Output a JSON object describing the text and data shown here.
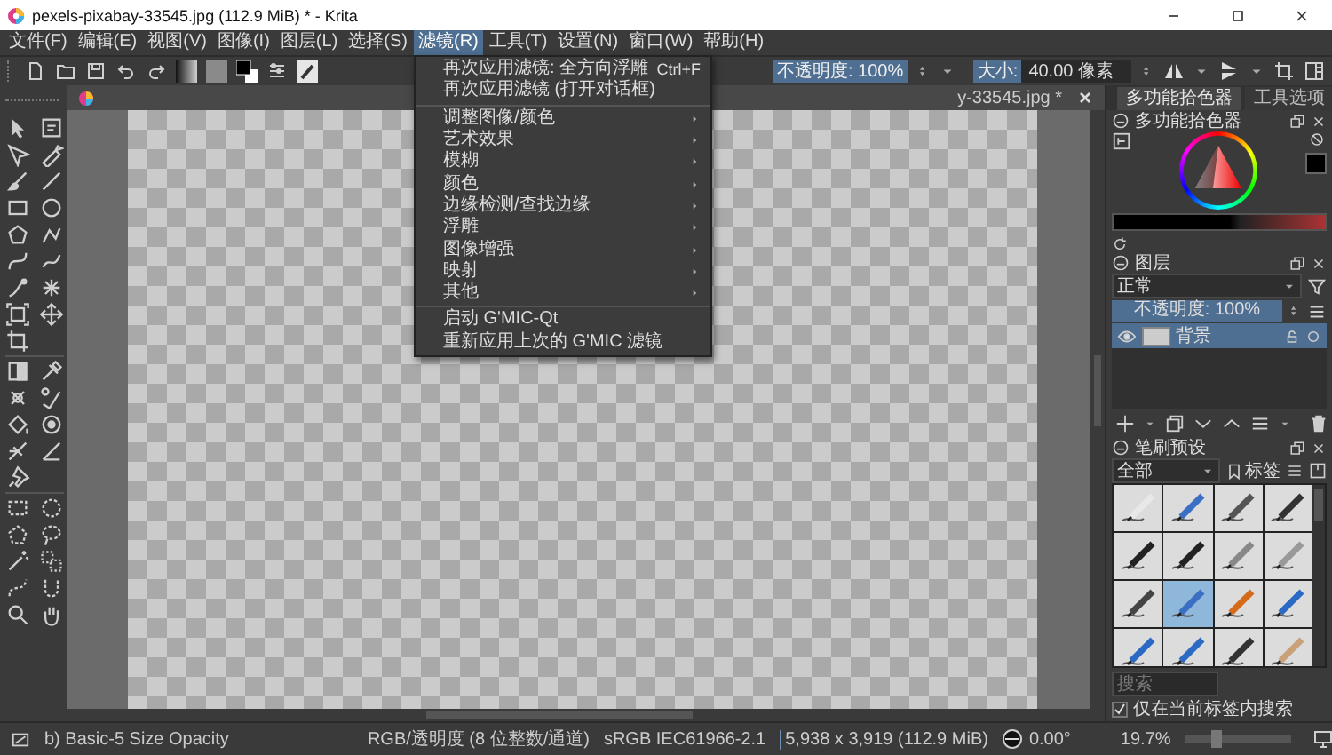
{
  "window": {
    "title": "pexels-pixabay-33545.jpg (112.9 MiB) * - Krita"
  },
  "menu_bar": [
    {
      "label": "文件(F)",
      "selected": false
    },
    {
      "label": "编辑(E)",
      "selected": false
    },
    {
      "label": "视图(V)",
      "selected": false
    },
    {
      "label": "图像(I)",
      "selected": false
    },
    {
      "label": "图层(L)",
      "selected": false
    },
    {
      "label": "选择(S)",
      "selected": false
    },
    {
      "label": "滤镜(R)",
      "selected": true
    },
    {
      "label": "工具(T)",
      "selected": false
    },
    {
      "label": "设置(N)",
      "selected": false
    },
    {
      "label": "窗口(W)",
      "selected": false
    },
    {
      "label": "帮助(H)",
      "selected": false
    }
  ],
  "filter_menu": {
    "groups": [
      [
        {
          "label": "再次应用滤镜: 全方向浮雕",
          "shortcut": "Ctrl+F",
          "kind": "action"
        },
        {
          "label": "再次应用滤镜 (打开对话框)",
          "kind": "action"
        }
      ],
      [
        {
          "label": "调整图像/颜色",
          "kind": "submenu"
        },
        {
          "label": "艺术效果",
          "kind": "submenu"
        },
        {
          "label": "模糊",
          "kind": "submenu"
        },
        {
          "label": "颜色",
          "kind": "submenu"
        },
        {
          "label": "边缘检测/查找边缘",
          "kind": "submenu"
        },
        {
          "label": "浮雕",
          "kind": "submenu"
        },
        {
          "label": "图像增强",
          "kind": "submenu"
        },
        {
          "label": "映射",
          "kind": "submenu"
        },
        {
          "label": "其他",
          "kind": "submenu"
        }
      ],
      [
        {
          "label": "启动 G'MIC-Qt",
          "kind": "action"
        },
        {
          "label": "重新应用上次的 G'MIC 滤镜",
          "kind": "action"
        }
      ]
    ]
  },
  "toolbar": {
    "opacity": {
      "text": "不透明度: 100%",
      "level": 1
    },
    "size": {
      "label": "大小:",
      "value": "40.00 像素",
      "level": 0.3
    }
  },
  "document_tab": {
    "label": "y-33545.jpg *"
  },
  "dock": {
    "tabs": [
      {
        "label": "多功能拾色器",
        "selected": true
      },
      {
        "label": "工具选项",
        "selected": false
      }
    ],
    "color_selector": {
      "title": "多功能拾色器"
    },
    "layers": {
      "title": "图层",
      "blend_mode": "正常",
      "opacity": {
        "text": "不透明度: 100%",
        "level": 1
      },
      "items": [
        {
          "name": "背景",
          "selected": true,
          "visible": true
        }
      ]
    },
    "brush_presets": {
      "title": "笔刷预设",
      "filter": "全部",
      "tag_label": "标签",
      "search": {
        "placeholder": "搜索"
      },
      "search_in_tag": {
        "label": "仅在当前标签内搜索",
        "checked": true
      },
      "presets": [
        {
          "selected": false
        },
        {
          "selected": false
        },
        {
          "selected": false
        },
        {
          "selected": false
        },
        {
          "selected": false
        },
        {
          "selected": false
        },
        {
          "selected": false
        },
        {
          "selected": false
        },
        {
          "selected": false
        },
        {
          "selected": true
        },
        {
          "selected": false
        },
        {
          "selected": false
        },
        {
          "selected": false
        },
        {
          "selected": false
        },
        {
          "selected": false
        },
        {
          "selected": false
        }
      ]
    }
  },
  "status_bar": {
    "brush": "b) Basic-5 Size Opacity",
    "color_model": "RGB/透明度 (8 位整数/通道)",
    "profile": "sRGB IEC61966-2.1",
    "image_size": "5,938 x 3,919 (112.9 MiB)",
    "rotation": "0.00°",
    "zoom": "19.7%",
    "zoom_slider": {
      "level": 0.3
    }
  }
}
